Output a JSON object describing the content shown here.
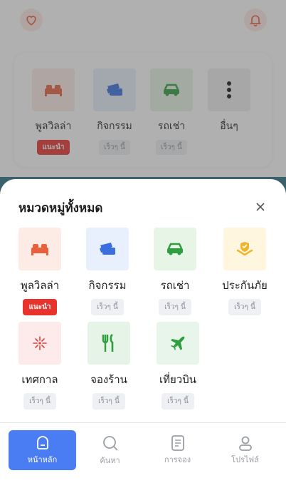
{
  "background": {
    "categories": [
      {
        "label": "พูลวิลล่า",
        "tag": "แนะนำ",
        "tag_type": "recommended",
        "icon": "bed-icon"
      },
      {
        "label": "กิจกรรม",
        "tag": "เร็วๆ นี้",
        "tag_type": "soon",
        "icon": "ticket-icon"
      },
      {
        "label": "รถเช่า",
        "tag": "เร็วๆ นี้",
        "tag_type": "soon",
        "icon": "car-icon"
      },
      {
        "label": "อื่นๆ",
        "icon": "more-vertical-icon"
      }
    ]
  },
  "sheet": {
    "title": "หมวดหมู่ทั้งหมด",
    "categories": [
      {
        "label": "พูลวิลล่า",
        "tag": "แนะนำ",
        "tag_type": "recommended",
        "icon": "bed-icon"
      },
      {
        "label": "กิจกรรม",
        "tag": "เร็วๆ นี้",
        "tag_type": "soon",
        "icon": "ticket-icon"
      },
      {
        "label": "รถเช่า",
        "tag": "เร็วๆ นี้",
        "tag_type": "soon",
        "icon": "car-icon"
      },
      {
        "label": "ประกันภัย",
        "tag": "เร็วๆ นี้",
        "tag_type": "soon",
        "icon": "insurance-icon"
      },
      {
        "label": "เทศกาล",
        "tag": "เร็วๆ นี้",
        "tag_type": "soon",
        "icon": "fireworks-icon"
      },
      {
        "label": "จองร้าน",
        "tag": "เร็วๆ นี้",
        "tag_type": "soon",
        "icon": "restaurant-icon"
      },
      {
        "label": "เที่ยวบิน",
        "tag": "เร็วๆ นี้",
        "tag_type": "soon",
        "icon": "airplane-icon"
      }
    ]
  },
  "nav": {
    "items": [
      {
        "label": "หน้าหลัก",
        "icon": "home-icon",
        "active": true
      },
      {
        "label": "ค้นหา",
        "icon": "search-icon",
        "active": false
      },
      {
        "label": "การจอง",
        "icon": "document-icon",
        "active": false
      },
      {
        "label": "โปรไฟล์",
        "icon": "user-icon",
        "active": false
      }
    ]
  },
  "colors": {
    "accent": "#4a7cf3",
    "recommended": "#e8322c",
    "villa_tile": "#fdece6",
    "activity_tile": "#e8f0fd",
    "car_tile": "#e6f5e6",
    "insurance_tile": "#fff6e0",
    "festival_tile": "#fdeaea",
    "restaurant_tile": "#e6f4e8",
    "flight_tile": "#e8f5ea"
  }
}
